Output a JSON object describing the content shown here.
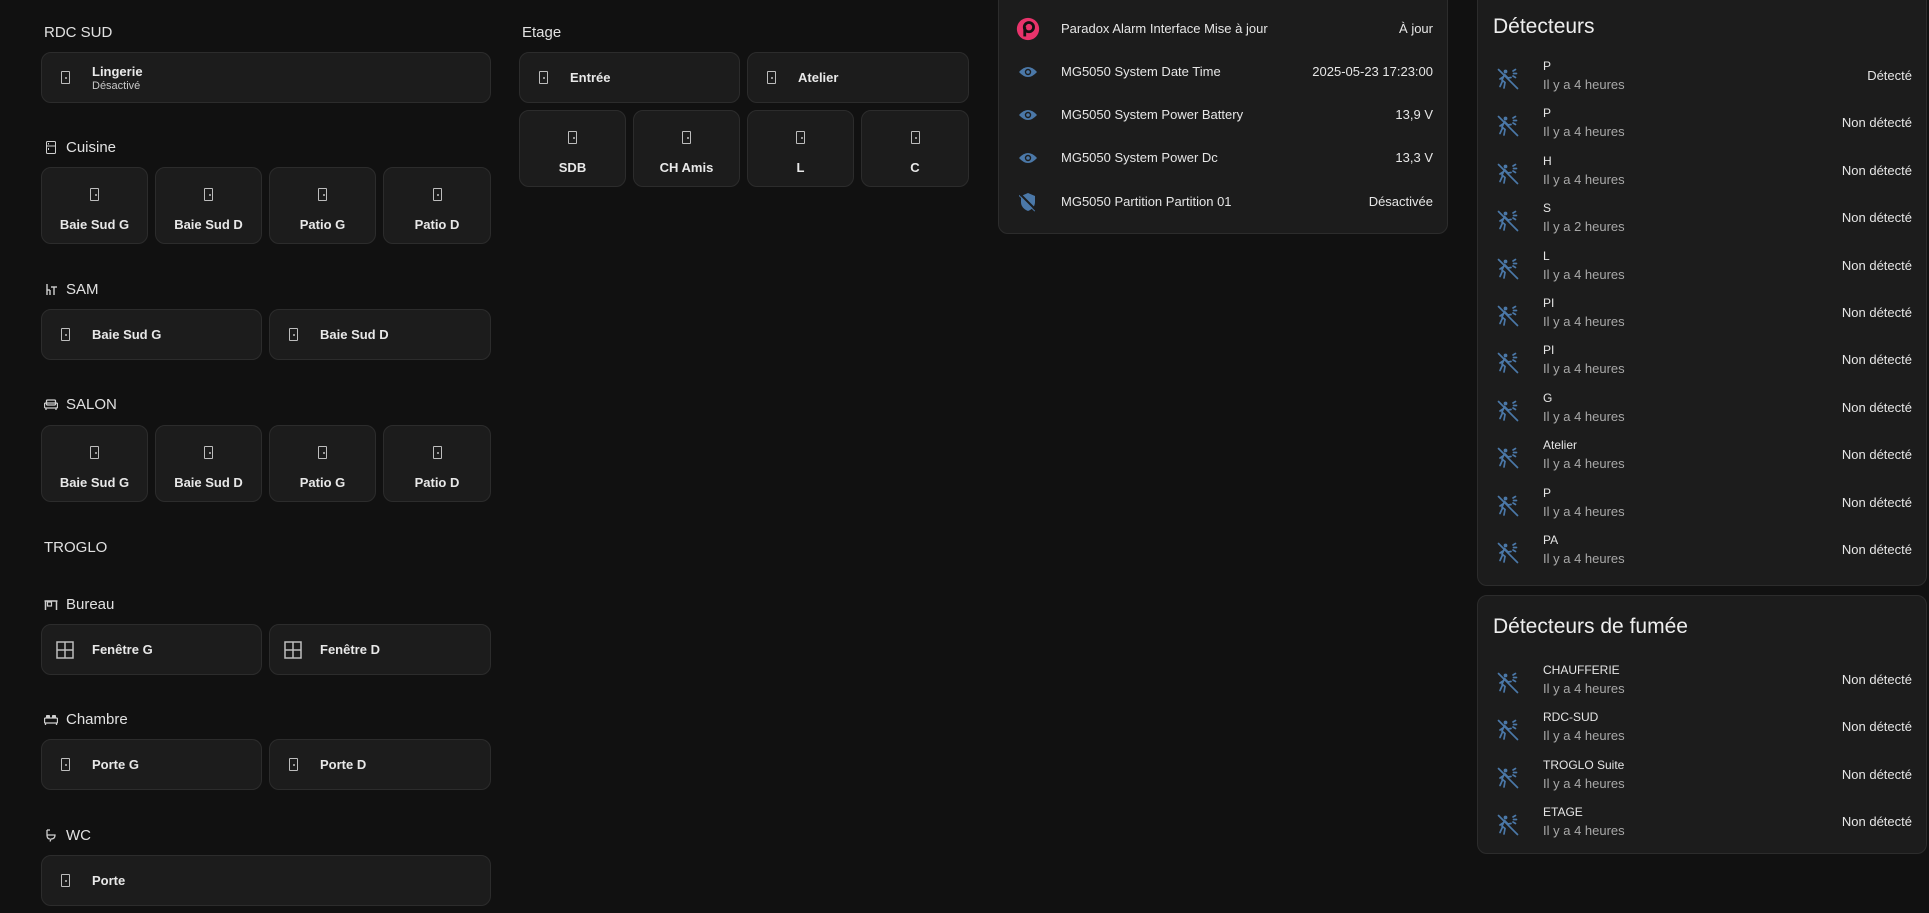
{
  "rdc_sud": {
    "title": "RDC SUD",
    "lingerie": {
      "name": "Lingerie",
      "state": "Désactivé"
    }
  },
  "cuisine": {
    "title": "Cuisine",
    "tiles": [
      "Baie Sud G",
      "Baie Sud D",
      "Patio G",
      "Patio D"
    ]
  },
  "sam": {
    "title": "SAM",
    "tiles": [
      "Baie Sud G",
      "Baie Sud D"
    ]
  },
  "salon": {
    "title": "SALON",
    "tiles": [
      "Baie Sud G",
      "Baie Sud D",
      "Patio G",
      "Patio D"
    ]
  },
  "troglo": {
    "title": "TROGLO"
  },
  "bureau": {
    "title": "Bureau",
    "tiles": [
      "Fenêtre G",
      "Fenêtre D"
    ]
  },
  "chambre": {
    "title": "Chambre",
    "tiles": [
      "Porte G",
      "Porte D"
    ]
  },
  "wc": {
    "title": "WC",
    "tiles": [
      "Porte"
    ]
  },
  "etage": {
    "title": "Etage",
    "top_tiles": [
      "Entrée",
      "Atelier"
    ],
    "bottom_tiles": [
      "SDB",
      "CH Amis",
      "L",
      "C"
    ]
  },
  "system": {
    "rows": [
      {
        "icon": "paradox-logo-icon",
        "name": "Paradox Alarm Interface Mise à jour",
        "value": "À jour"
      },
      {
        "icon": "eye-icon",
        "name": "MG5050 System Date Time",
        "value": "2025-05-23 17:23:00"
      },
      {
        "icon": "eye-icon",
        "name": "MG5050 System Power Battery",
        "value": "13,9 V"
      },
      {
        "icon": "eye-icon",
        "name": "MG5050 System Power Dc",
        "value": "13,3 V"
      },
      {
        "icon": "shield-off-icon",
        "name": "MG5050 Partition Partition 01",
        "value": "Désactivée"
      }
    ]
  },
  "detecteurs": {
    "title": "Détecteurs",
    "rows": [
      {
        "name": "P",
        "time": "Il y a 4 heures",
        "state": "Détecté"
      },
      {
        "name": "P",
        "time": "Il y a 4 heures",
        "state": "Non détecté"
      },
      {
        "name": "H",
        "time": "Il y a 4 heures",
        "state": "Non détecté"
      },
      {
        "name": "S",
        "time": "Il y a 2 heures",
        "state": "Non détecté"
      },
      {
        "name": "L",
        "time": "Il y a 4 heures",
        "state": "Non détecté"
      },
      {
        "name": "PI",
        "time": "Il y a 4 heures",
        "state": "Non détecté"
      },
      {
        "name": "PI",
        "time": "Il y a 4 heures",
        "state": "Non détecté"
      },
      {
        "name": "G",
        "time": "Il y a 4 heures",
        "state": "Non détecté"
      },
      {
        "name": "Atelier",
        "time": "Il y a 4 heures",
        "state": "Non détecté"
      },
      {
        "name": "P",
        "time": "Il y a 4 heures",
        "state": "Non détecté"
      },
      {
        "name": "PA",
        "time": "Il y a 4 heures",
        "state": "Non détecté"
      }
    ]
  },
  "fumee": {
    "title": "Détecteurs de fumée",
    "rows": [
      {
        "name": "CHAUFFERIE",
        "time": "Il y a 4 heures",
        "state": "Non détecté"
      },
      {
        "name": "RDC-SUD",
        "time": "Il y a 4 heures",
        "state": "Non détecté"
      },
      {
        "name": "TROGLO Suite",
        "time": "Il y a 4 heures",
        "state": "Non détecté"
      },
      {
        "name": "ETAGE",
        "time": "Il y a 4 heures",
        "state": "Non détecté"
      }
    ]
  },
  "colors": {
    "background": "#111111",
    "card": "#1c1c1c",
    "accent_icon": "#4b78a8",
    "paradox": "#e8336b"
  }
}
